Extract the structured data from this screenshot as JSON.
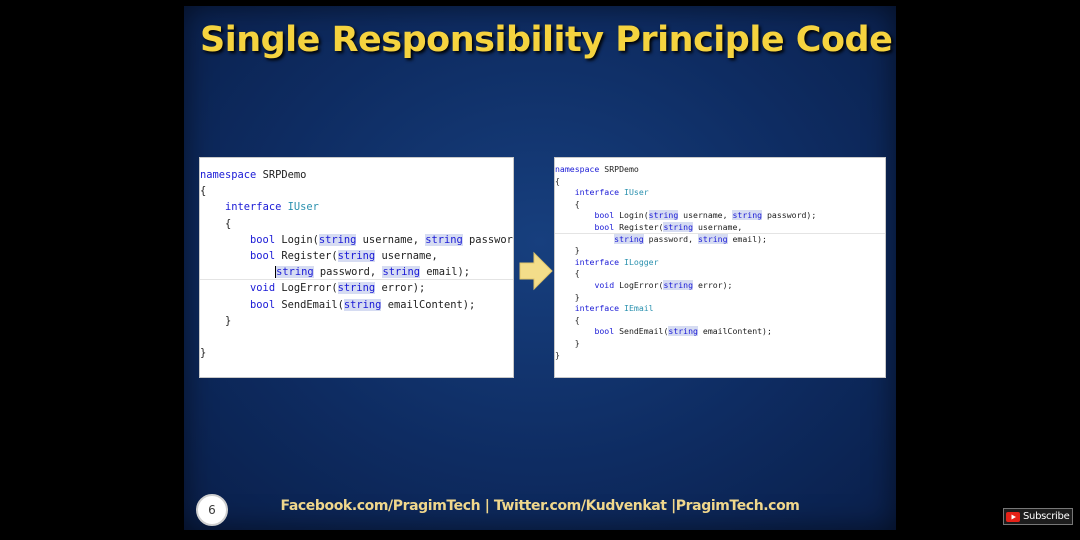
{
  "slide": {
    "title": "Single Responsibility Principle Code",
    "number": "6",
    "footer": "Facebook.com/PragimTech | Twitter.com/Kudvenkat |PragimTech.com"
  },
  "colors": {
    "title": "#f5d33f",
    "footer": "#f0d78c",
    "background": "#0e2c62",
    "keyword": "#1a1ad6",
    "type": "#2b91af",
    "arrow": "#f3dd8a"
  },
  "icons": {
    "arrow": "right-arrow-icon",
    "subscribe": "youtube-play-icon"
  },
  "code_before": {
    "lines": [
      [
        {
          "t": "namespace",
          "c": "kw"
        },
        {
          "t": " SRPDemo"
        }
      ],
      [
        {
          "t": "{"
        }
      ],
      [
        {
          "t": "    "
        },
        {
          "t": "interface",
          "c": "kw"
        },
        {
          "t": " "
        },
        {
          "t": "IUser",
          "c": "type"
        }
      ],
      [
        {
          "t": "    {"
        }
      ],
      [
        {
          "t": "        "
        },
        {
          "t": "bool",
          "c": "kw"
        },
        {
          "t": " Login("
        },
        {
          "t": "string",
          "c": "kw hl"
        },
        {
          "t": " username, "
        },
        {
          "t": "string",
          "c": "kw hl"
        },
        {
          "t": " password);"
        }
      ],
      [
        {
          "t": "        "
        },
        {
          "t": "bool",
          "c": "kw"
        },
        {
          "t": " Register("
        },
        {
          "t": "string",
          "c": "kw hl"
        },
        {
          "t": " username,"
        }
      ],
      [
        {
          "t": "            "
        },
        {
          "t": "string",
          "c": "kw hl cursor"
        },
        {
          "t": " password, "
        },
        {
          "t": "string",
          "c": "kw hl"
        },
        {
          "t": " email);"
        }
      ],
      [
        {
          "t": "        "
        },
        {
          "t": "void",
          "c": "kw"
        },
        {
          "t": " LogError("
        },
        {
          "t": "string",
          "c": "kw hl"
        },
        {
          "t": " error);"
        }
      ],
      [
        {
          "t": "        "
        },
        {
          "t": "bool",
          "c": "kw"
        },
        {
          "t": " SendEmail("
        },
        {
          "t": "string",
          "c": "kw hl"
        },
        {
          "t": " emailContent);"
        }
      ],
      [
        {
          "t": "    }"
        }
      ],
      [
        {
          "t": ""
        }
      ],
      [
        {
          "t": "}"
        }
      ]
    ]
  },
  "code_after": {
    "lines": [
      [
        {
          "t": "namespace",
          "c": "kw"
        },
        {
          "t": " SRPDemo"
        }
      ],
      [
        {
          "t": "{"
        }
      ],
      [
        {
          "t": "    "
        },
        {
          "t": "interface",
          "c": "kw"
        },
        {
          "t": " "
        },
        {
          "t": "IUser",
          "c": "type"
        }
      ],
      [
        {
          "t": "    {"
        }
      ],
      [
        {
          "t": "        "
        },
        {
          "t": "bool",
          "c": "kw"
        },
        {
          "t": " Login("
        },
        {
          "t": "string",
          "c": "kw hl"
        },
        {
          "t": " username, "
        },
        {
          "t": "string",
          "c": "kw hl"
        },
        {
          "t": " password);"
        }
      ],
      [
        {
          "t": "        "
        },
        {
          "t": "bool",
          "c": "kw"
        },
        {
          "t": " Register("
        },
        {
          "t": "string",
          "c": "kw hl"
        },
        {
          "t": " username,"
        }
      ],
      [
        {
          "t": "            "
        },
        {
          "t": "string",
          "c": "kw hl"
        },
        {
          "t": " password, "
        },
        {
          "t": "string",
          "c": "kw hl"
        },
        {
          "t": " email);"
        }
      ],
      [
        {
          "t": "    }"
        }
      ],
      [
        {
          "t": "    "
        },
        {
          "t": "interface",
          "c": "kw"
        },
        {
          "t": " "
        },
        {
          "t": "ILogger",
          "c": "type"
        }
      ],
      [
        {
          "t": "    {"
        }
      ],
      [
        {
          "t": "        "
        },
        {
          "t": "void",
          "c": "kw"
        },
        {
          "t": " LogError("
        },
        {
          "t": "string",
          "c": "kw hl"
        },
        {
          "t": " error);"
        }
      ],
      [
        {
          "t": "    }"
        }
      ],
      [
        {
          "t": "    "
        },
        {
          "t": "interface",
          "c": "kw"
        },
        {
          "t": " "
        },
        {
          "t": "IEmail",
          "c": "type"
        }
      ],
      [
        {
          "t": "    {"
        }
      ],
      [
        {
          "t": "        "
        },
        {
          "t": "bool",
          "c": "kw"
        },
        {
          "t": " SendEmail("
        },
        {
          "t": "string",
          "c": "kw hl"
        },
        {
          "t": " emailContent);"
        }
      ],
      [
        {
          "t": "    }"
        }
      ],
      [
        {
          "t": "}"
        }
      ]
    ]
  },
  "subscribe": {
    "label": "Subscribe"
  }
}
